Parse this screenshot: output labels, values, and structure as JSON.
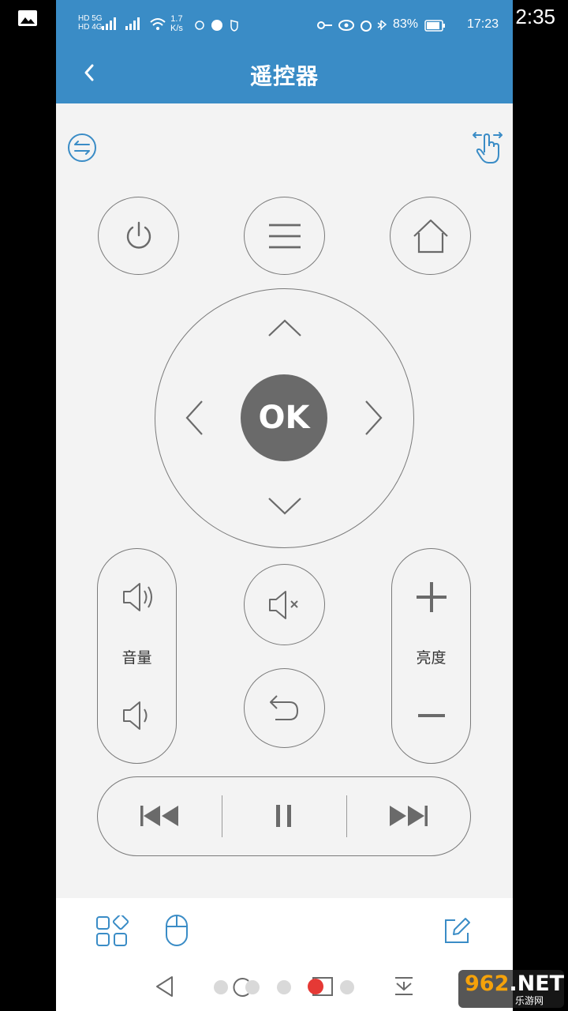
{
  "outer_status": {
    "time": "2:35"
  },
  "statusbar": {
    "net1": "HD 5G",
    "net2": "HD 4G",
    "speed_value": "1.7",
    "speed_unit": "K/s",
    "battery_percent": "83%",
    "time": "17:23"
  },
  "header": {
    "title": "遥控器"
  },
  "controls": {
    "ok_label": "OK",
    "volume_label": "音量",
    "brightness_label": "亮度"
  },
  "watermark": {
    "brand_number": "962",
    "brand_suffix": ".NET",
    "site_name": "乐游网"
  },
  "colors": {
    "accent": "#3a8cc6",
    "icon_gray": "#6a6a6a",
    "outline": "#7a7a7a",
    "background": "#f3f3f3"
  }
}
